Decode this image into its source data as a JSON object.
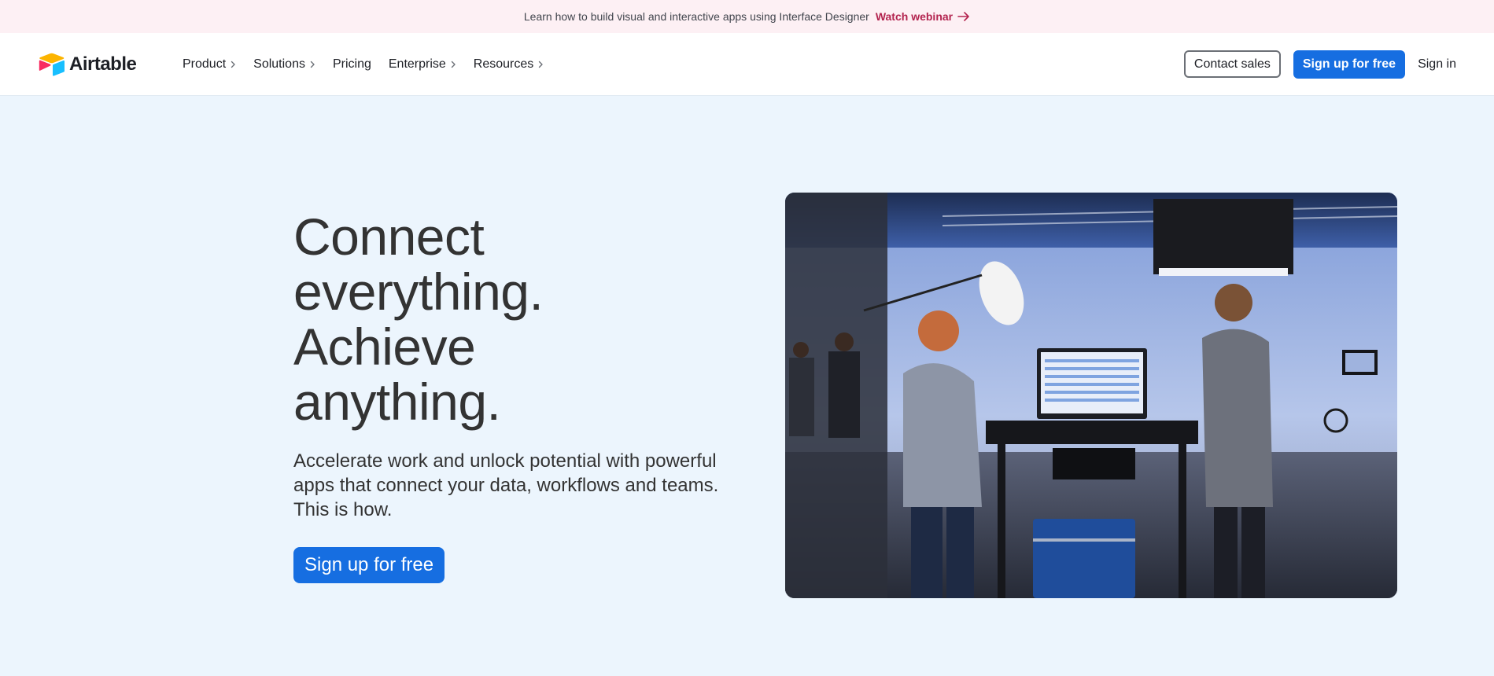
{
  "banner": {
    "text": "Learn how to build visual and interactive apps using Interface Designer",
    "link_label": "Watch webinar"
  },
  "header": {
    "logo_text": "Airtable",
    "nav": [
      {
        "label": "Product",
        "has_menu": true
      },
      {
        "label": "Solutions",
        "has_menu": true
      },
      {
        "label": "Pricing",
        "has_menu": false
      },
      {
        "label": "Enterprise",
        "has_menu": true
      },
      {
        "label": "Resources",
        "has_menu": true
      }
    ],
    "contact_sales_label": "Contact sales",
    "signup_label": "Sign up for free",
    "signin_label": "Sign in"
  },
  "hero": {
    "title_lines": [
      "Connect",
      "everything.",
      "Achieve",
      "anything."
    ],
    "subtitle": "Accelerate work and unlock potential with powerful apps that connect your data, workflows and teams. This is how.",
    "cta_label": "Sign up for free"
  },
  "colors": {
    "brand_blue": "#166ee1",
    "banner_bg": "#fdf0f4",
    "banner_link": "#b3244f",
    "page_bg": "#ecf5fd",
    "logo_yellow": "#fcb400",
    "logo_blue": "#18bfff",
    "logo_red": "#f82b60"
  },
  "icons": {
    "banner_arrow": "arrow-right-icon",
    "nav_chevron": "chevron-right-icon",
    "logo": "airtable-logo-icon"
  }
}
